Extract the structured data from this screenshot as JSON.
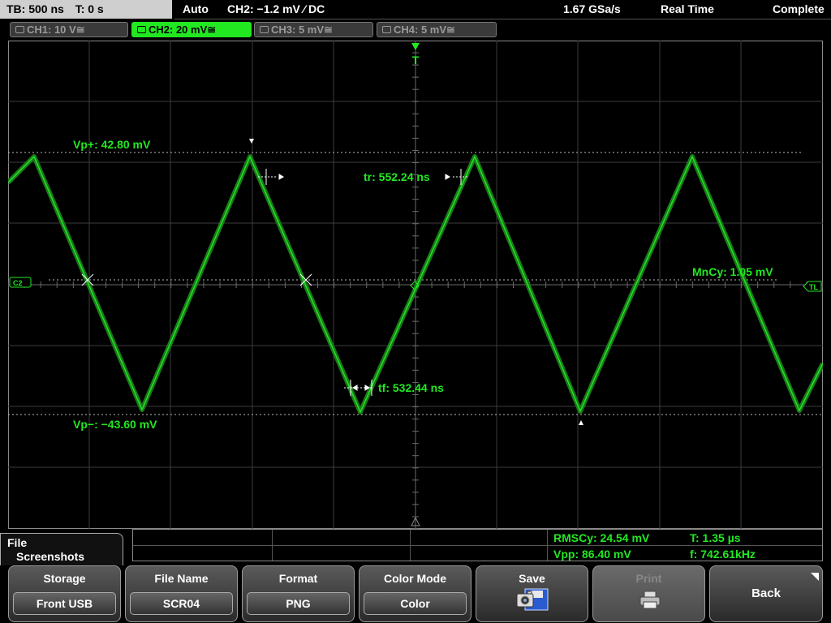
{
  "status": {
    "timebase": "TB: 500 ns",
    "trigger_time": "T: 0 s",
    "mode": "Auto",
    "trigger_info": "CH2: −1.2 mV ⁄ DC",
    "sample_rate": "1.67 GSa/s",
    "acq_mode": "Real Time",
    "state": "Complete"
  },
  "channels": [
    {
      "label": "CH1: 10 V≅",
      "active": false
    },
    {
      "label": "CH2: 20 mV≅",
      "active": true
    },
    {
      "label": "CH3: 5 mV≅",
      "active": false
    },
    {
      "label": "CH4: 5 mV≅",
      "active": false
    }
  ],
  "markers": {
    "trigger_top": "T",
    "ch2_ref": "C2",
    "trigger_level": "TL"
  },
  "annotations": {
    "vp_plus": "Vp+: 42.80 mV",
    "vp_minus": "Vp−: −43.60 mV",
    "rise": "tr: 552.24 ns",
    "fall": "tf: 532.44 ns",
    "mean_cycle": "MnCy: 1.05 mV"
  },
  "measurements": {
    "rms": "RMSCy: 24.54 mV",
    "period": "T: 1.35 µs",
    "vpp": "Vpp: 86.40 mV",
    "freq": "f: 742.61kHz"
  },
  "menu": {
    "title_line1": "File",
    "title_line2": "Screenshots"
  },
  "softkeys": {
    "storage_label": "Storage",
    "storage_value": "Front USB",
    "filename_label": "File Name",
    "filename_value": "SCR04",
    "format_label": "Format",
    "format_value": "PNG",
    "colormode_label": "Color Mode",
    "colormode_value": "Color",
    "save_label": "Save",
    "print_label": "Print",
    "back_label": "Back"
  },
  "colors": {
    "trace": "#22e822",
    "grid": "#3c3c3c",
    "text": "#ffffff"
  }
}
